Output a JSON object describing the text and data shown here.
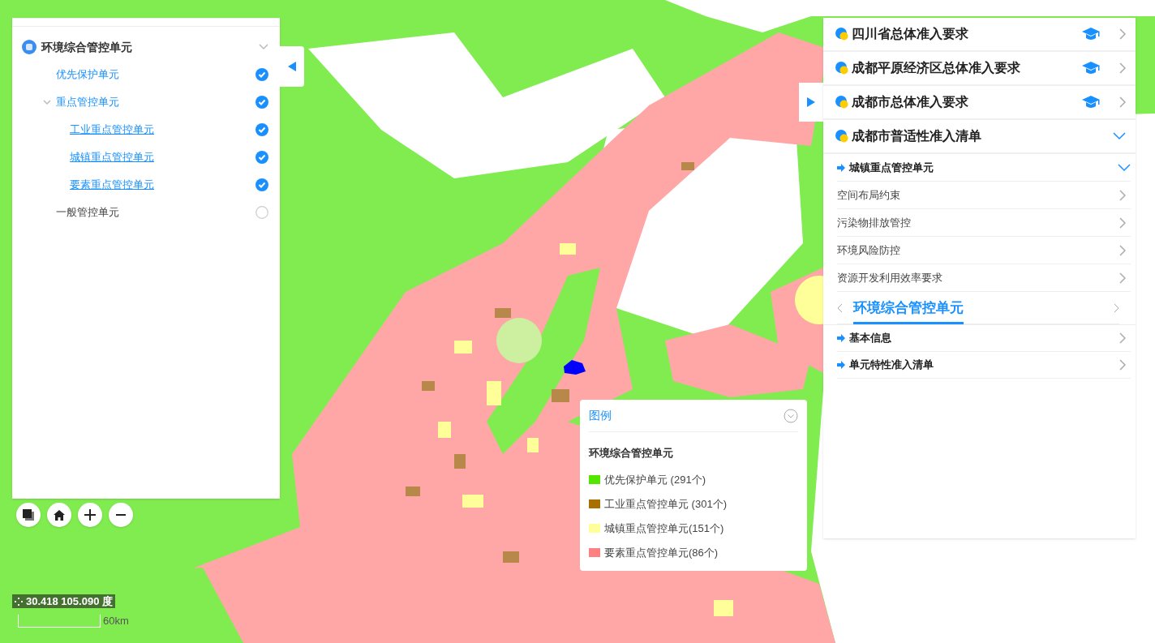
{
  "layer_tree": {
    "title": "环境综合管控单元",
    "expanded": true,
    "items": [
      {
        "label": "优先保护单元",
        "checked": true
      },
      {
        "label": "重点管控单元",
        "checked": true,
        "expanded": true,
        "children": [
          {
            "label": "工业重点管控单元",
            "checked": true
          },
          {
            "label": "城镇重点管控单元",
            "checked": true
          },
          {
            "label": "要素重点管控单元",
            "checked": true
          }
        ]
      },
      {
        "label": "一般管控单元",
        "checked": false
      }
    ]
  },
  "requirements": [
    {
      "title": "四川省总体准入要求",
      "expanded": false
    },
    {
      "title": "成都平原经济区总体准入要求",
      "expanded": false
    },
    {
      "title": "成都市总体准入要求",
      "expanded": false
    },
    {
      "title": "成都市普适性准入清单",
      "expanded": true
    }
  ],
  "sub_section": {
    "title": "城镇重点管控单元",
    "expanded": true,
    "items": [
      "空间布局约束",
      "污染物排放管控",
      "环境风险防控",
      "资源开发利用效率要求"
    ]
  },
  "unit_tab": {
    "label": "环境综合管控单元"
  },
  "info_items": [
    "基本信息",
    "单元特性准入清单"
  ],
  "legend": {
    "title": "图例",
    "subtitle": "环境综合管控单元",
    "items": [
      {
        "label": "优先保护单元 (291个)",
        "color": "#55e600"
      },
      {
        "label": "工业重点管控单元 (301个)",
        "color": "#a87000"
      },
      {
        "label": "城镇重点管控单元(151个)",
        "color": "#ffff99"
      },
      {
        "label": "要素重点管控单元(86个)",
        "color": "#ff8080"
      }
    ]
  },
  "coordinates": "30.418 105.090 度",
  "scale": "60km"
}
